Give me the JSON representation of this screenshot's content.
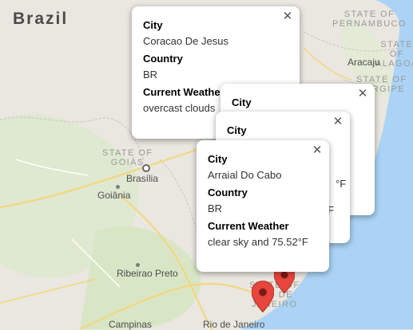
{
  "map": {
    "country_label": "Brazil",
    "region_labels": [
      "STATE OF\nPERNAMBUCO",
      "STATE OF\nALAGOA",
      "STATE OF\nSERGIPE",
      "STATE OF\nGOIÁS",
      "STATE OF\nRIO DE\nJANEIRO"
    ],
    "cities": [
      "Aracaju",
      "Brasília",
      "Goiânia",
      "Ribeirao Preto",
      "Campinas",
      "Rio de Janeiro"
    ],
    "colors": {
      "land": "#e9e7df",
      "land_green": "#d8e6c7",
      "water": "#aad3f5",
      "roads": "#f5d67a",
      "marker": "#e8453c"
    }
  },
  "info_windows": [
    {
      "city_label": "City",
      "city": "Coracao De Jesus",
      "country_label": "Country",
      "country": "BR",
      "weather_label": "Current Weather",
      "weather": "overcast clouds"
    },
    {
      "city_label": "City"
    },
    {
      "city_label": "City",
      "weather_fragment_1": "°F",
      "weather_fragment_2": "F"
    },
    {
      "city_label": "City",
      "city": "Arraial Do Cabo",
      "country_label": "Country",
      "country": "BR",
      "weather_label": "Current Weather",
      "weather": "clear sky and 75.52°F"
    }
  ]
}
